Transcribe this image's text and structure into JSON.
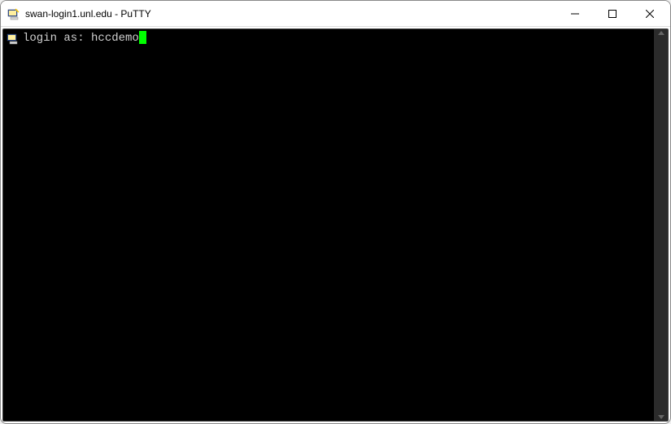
{
  "window": {
    "title": "swan-login1.unl.edu - PuTTY"
  },
  "terminal": {
    "prompt": "login as: ",
    "input": "hccdemo"
  }
}
